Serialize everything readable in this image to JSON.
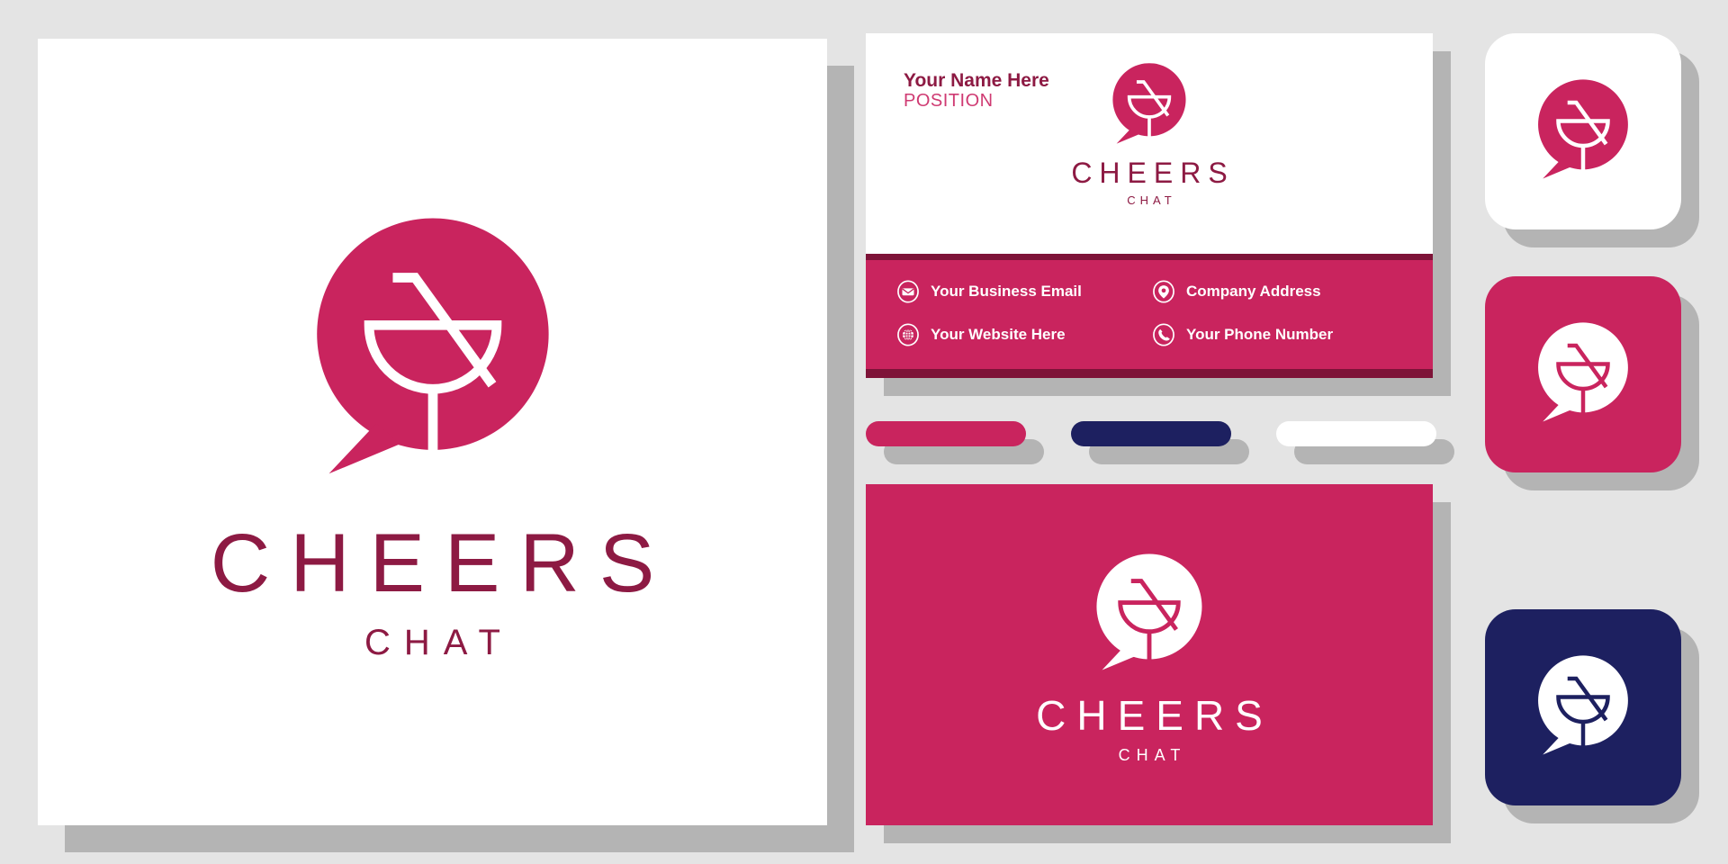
{
  "brand": {
    "name": "CHEERS",
    "tagline": "CHAT",
    "colors": {
      "pink": "#c9245e",
      "maroon": "#8d1a43",
      "dark_maroon": "#7e1338",
      "navy": "#1d2060",
      "white": "#ffffff",
      "canvas": "#e4e4e4",
      "shadow": "#b4b4b4",
      "position_pink": "#cf3a72"
    },
    "mark_icon": "speech-bubble-cocktail-glass-icon"
  },
  "main_card": {
    "wordmark": "CHEERS",
    "subtitle": "CHAT"
  },
  "business_card": {
    "name": "Your Name Here",
    "position": "POSITION",
    "wordmark": "CHEERS",
    "subtitle": "CHAT",
    "contacts": [
      {
        "icon": "envelope-icon",
        "label": "Your Business Email"
      },
      {
        "icon": "location-pin-icon",
        "label": "Company Address"
      },
      {
        "icon": "globe-icon",
        "label": "Your Website Here"
      },
      {
        "icon": "phone-icon",
        "label": "Your Phone Number"
      }
    ]
  },
  "swatches": [
    {
      "name": "pink-swatch",
      "color": "#c9245e"
    },
    {
      "name": "navy-swatch",
      "color": "#1d2060"
    },
    {
      "name": "white-swatch",
      "color": "#ffffff"
    }
  ],
  "banner": {
    "wordmark": "CHEERS",
    "subtitle": "CHAT",
    "background": "#c9245e"
  },
  "tiles": [
    {
      "name": "tile-white",
      "background": "#ffffff",
      "bubble": "#c9245e",
      "glass": "#ffffff"
    },
    {
      "name": "tile-pink",
      "background": "#c9245e",
      "bubble": "#ffffff",
      "glass": "#c9245e"
    },
    {
      "name": "tile-navy",
      "background": "#1d2060",
      "bubble": "#ffffff",
      "glass": "#1d2060"
    }
  ]
}
